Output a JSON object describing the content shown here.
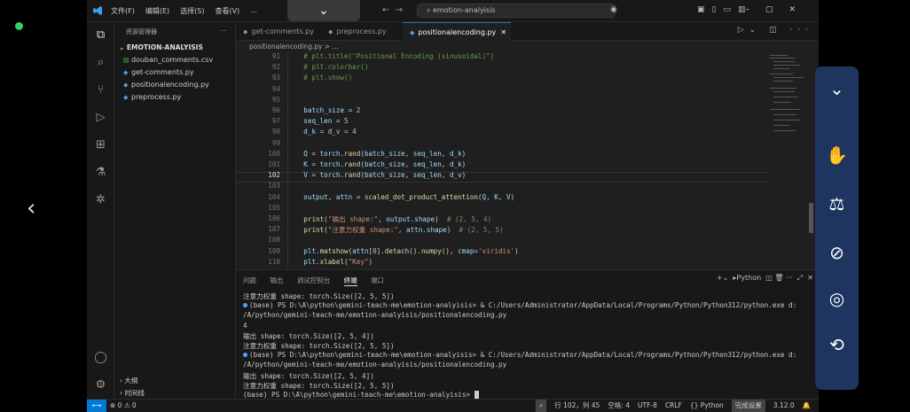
{
  "overlay": {
    "back_arrow": "‹",
    "pulldown_glyph": "⌄",
    "right_panel_icons": [
      "chevron-down-icon",
      "no-touch-icon",
      "weight-icon",
      "no-signal-icon",
      "eye-off-icon",
      "rotate-icon"
    ]
  },
  "titlebar": {
    "menu": [
      "文件(F)",
      "编辑(E)",
      "选择(S)",
      "查看(V)",
      "..."
    ],
    "search": "emotion-analyisis",
    "nav_back": "←",
    "nav_forward": "→"
  },
  "sidebar": {
    "title": "资源管理器",
    "dots": "···",
    "folder": "EMOTION-ANALYISIS",
    "files": [
      "douban_comments.csv",
      "get-comments.py",
      "positionalencoding.py",
      "preprocess.py"
    ],
    "outline": "大纲",
    "timeline": "时间线"
  },
  "tabs": [
    "get-comments.py",
    "preprocess.py",
    "positionalencoding.py"
  ],
  "breadcrumb": "positionalencoding.py > ...",
  "editor": {
    "lines": [
      {
        "n": "91",
        "t": "    # plt.title(\"Positional Encoding (sinusoidal)\")"
      },
      {
        "n": "92",
        "t": "    # plt.colorbar()"
      },
      {
        "n": "93",
        "t": "    # plt.show()"
      },
      {
        "n": "94",
        "t": ""
      },
      {
        "n": "95",
        "t": ""
      },
      {
        "n": "96",
        "t": "    batch_size = 2"
      },
      {
        "n": "97",
        "t": "    seq_len = 5"
      },
      {
        "n": "98",
        "t": "    d_k = d_v = 4"
      },
      {
        "n": "99",
        "t": ""
      },
      {
        "n": "100",
        "t": "    Q = torch.rand(batch_size, seq_len, d_k)"
      },
      {
        "n": "101",
        "t": "    K = torch.rand(batch_size, seq_len, d_k)"
      },
      {
        "n": "102",
        "t": "    V = torch.rand(batch_size, seq_len, d_v)"
      },
      {
        "n": "103",
        "t": ""
      },
      {
        "n": "104",
        "t": "    output, attn = scaled_dot_product_attention(Q, K, V)"
      },
      {
        "n": "105",
        "t": ""
      },
      {
        "n": "106",
        "t": "    print(\"输出 shape:\", output.shape)  # (2, 5, 4)"
      },
      {
        "n": "107",
        "t": "    print(\"注意力权重 shape:\", attn.shape)  # (2, 5, 5)"
      },
      {
        "n": "108",
        "t": ""
      },
      {
        "n": "109",
        "t": "    plt.matshow(attn[0].detach().numpy(), cmap='viridis')"
      },
      {
        "n": "110",
        "t": "    plt.xlabel(\"Key\")"
      }
    ],
    "current_line": "102"
  },
  "panel": {
    "tabs": [
      "问题",
      "输出",
      "调试控制台",
      "终端",
      "端口"
    ],
    "active_tab": "终端",
    "shell": "Python",
    "terminal": [
      "注意力权重 shape: torch.Size([2, 5, 5])",
      "(base) PS D:\\A\\python\\gemini-teach-me\\emotion-analyisis> & C:/Users/Administrator/AppData/Local/Programs/Python/Python312/python.exe d:",
      "/A/python/gemini-teach-me/emotion-analyisis/positionalencoding.py",
      "4",
      "输出 shape: torch.Size([2, 5, 4])",
      "注意力权重 shape: torch.Size([2, 5, 5])",
      "(base) PS D:\\A\\python\\gemini-teach-me\\emotion-analyisis> & C:/Users/Administrator/AppData/Local/Programs/Python/Python312/python.exe d:",
      "/A/python/gemini-teach-me/emotion-analyisis/positionalencoding.py",
      "输出 shape: torch.Size([2, 5, 4])",
      "注意力权重 shape: torch.Size([2, 5, 5])",
      "(base) PS D:\\A\\python\\gemini-teach-me\\emotion-analyisis> "
    ]
  },
  "statusbar": {
    "problems": "⊗ 0 ⚠ 0",
    "position": "行 102，列 45",
    "spaces": "空格: 4",
    "encoding": "UTF-8",
    "eol": "CRLF",
    "language": "{} Python",
    "setup": "完成设置",
    "python_version": "3.12.0"
  }
}
